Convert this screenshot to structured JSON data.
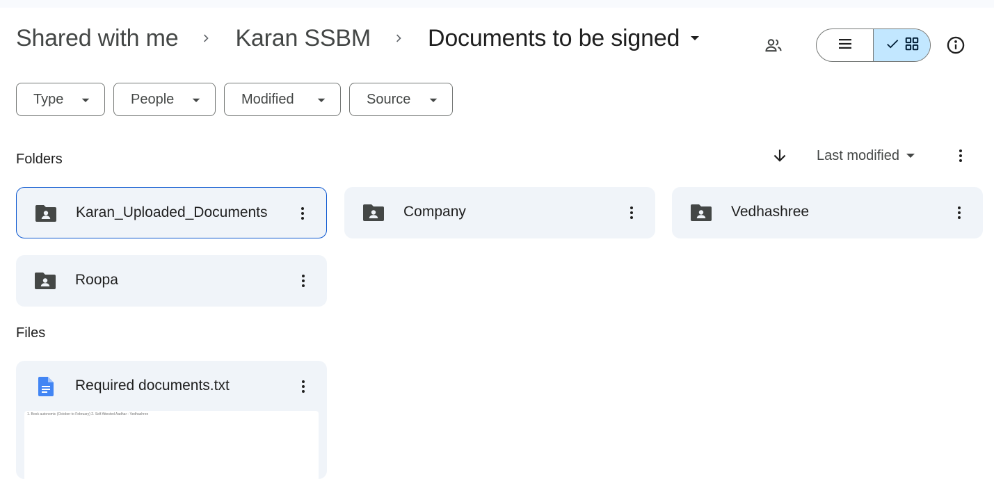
{
  "breadcrumb": {
    "items": [
      "Shared with me",
      "Karan SSBM"
    ],
    "current": "Documents to be signed"
  },
  "icons": {
    "separator": "chevron-right-icon",
    "folder_caret": "arrow-drop-down-icon",
    "people": "people-icon",
    "list_view": "list-view-icon",
    "grid_view_check": "check-icon",
    "grid_view": "grid-view-icon",
    "info": "info-icon"
  },
  "view": {
    "selected": "grid"
  },
  "filters": [
    "Type",
    "People",
    "Modified",
    "Source"
  ],
  "sections": {
    "folders": "Folders",
    "files": "Files"
  },
  "sort": {
    "direction_icon": "arrow-downward-icon",
    "label": "Last modified"
  },
  "folders": [
    {
      "name": "Karan_Uploaded_Documents",
      "selected": true
    },
    {
      "name": "Company",
      "selected": false
    },
    {
      "name": "Vedhashree",
      "selected": false
    },
    {
      "name": "Roopa",
      "selected": false
    }
  ],
  "files": [
    {
      "name": "Required documents.txt",
      "preview": "1. Book autonomic (October to February) 2. Self Attested Aadhar - Vedhashree"
    }
  ],
  "colors": {
    "selected_view_bg": "#c2e7ff",
    "card_bg": "#f0f4f9",
    "selected_border": "#0b57d0",
    "doc_icon": "#4285f4"
  }
}
